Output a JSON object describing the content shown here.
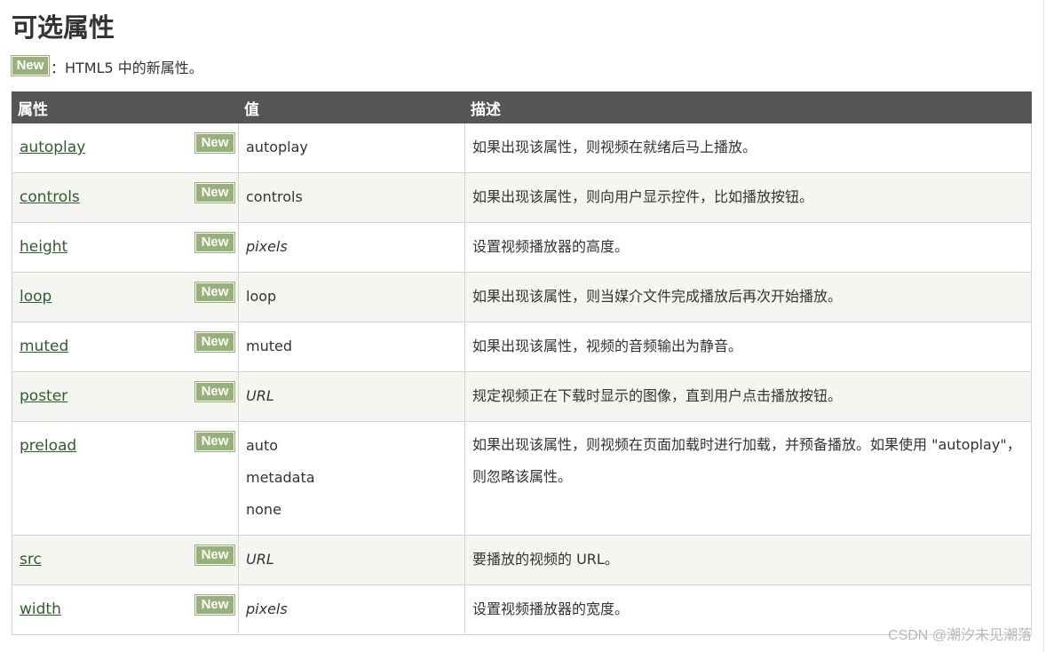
{
  "title": "可选属性",
  "legend": {
    "badge": "New",
    "text": "：HTML5 中的新属性。"
  },
  "table": {
    "headers": [
      "属性",
      "值",
      "描述"
    ],
    "rows": [
      {
        "attr": "autoplay",
        "badge": "New",
        "values": [
          "autoplay"
        ],
        "italic": false,
        "desc": "如果出现该属性，则视频在就绪后马上播放。"
      },
      {
        "attr": "controls",
        "badge": "New",
        "values": [
          "controls"
        ],
        "italic": false,
        "desc": "如果出现该属性，则向用户显示控件，比如播放按钮。"
      },
      {
        "attr": "height",
        "badge": "New",
        "values": [
          "pixels"
        ],
        "italic": true,
        "desc": "设置视频播放器的高度。"
      },
      {
        "attr": "loop",
        "badge": "New",
        "values": [
          "loop"
        ],
        "italic": false,
        "desc": "如果出现该属性，则当媒介文件完成播放后再次开始播放。"
      },
      {
        "attr": "muted",
        "badge": "New",
        "values": [
          "muted"
        ],
        "italic": false,
        "desc": "如果出现该属性，视频的音频输出为静音。"
      },
      {
        "attr": "poster",
        "badge": "New",
        "values": [
          "URL"
        ],
        "italic": true,
        "desc": "规定视频正在下载时显示的图像，直到用户点击播放按钮。"
      },
      {
        "attr": "preload",
        "badge": "New",
        "values": [
          "auto",
          "metadata",
          "none"
        ],
        "italic": false,
        "desc": "如果出现该属性，则视频在页面加载时进行加载，并预备播放。如果使用 \"autoplay\"，则忽略该属性。"
      },
      {
        "attr": "src",
        "badge": "New",
        "values": [
          "URL"
        ],
        "italic": true,
        "desc": "要播放的视频的 URL。"
      },
      {
        "attr": "width",
        "badge": "New",
        "values": [
          "pixels"
        ],
        "italic": true,
        "desc": "设置视频播放器的宽度。"
      }
    ]
  },
  "watermark": "CSDN @潮汐未见潮落",
  "colors": {
    "header_bg": "#555555",
    "badge_bg": "#97b279",
    "link": "#2d5e2b",
    "alt_row_bg": "#f5f5f2"
  }
}
